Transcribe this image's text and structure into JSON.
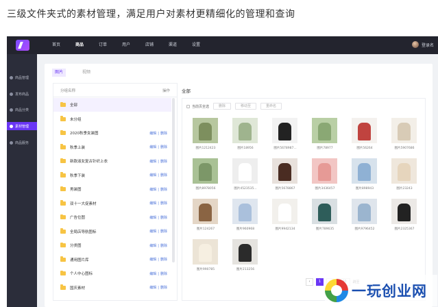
{
  "caption": "三级文件夹式的素材管理，满足用户对素材更精细化的管理和查询",
  "topbar": {
    "nav": [
      "首页",
      "商品",
      "订单",
      "用户",
      "店铺",
      "渠道",
      "设置"
    ],
    "active_nav": "商品",
    "user_label": "登录名"
  },
  "sidebar": {
    "items": [
      {
        "label": "商品管理",
        "icon": "box-icon"
      },
      {
        "label": "发布商品",
        "icon": "send-icon"
      },
      {
        "label": "商品分类",
        "icon": "category-icon"
      },
      {
        "label": "素材管理",
        "icon": "media-icon",
        "active": true
      },
      {
        "label": "商品服务",
        "icon": "service-icon"
      }
    ]
  },
  "tabs": [
    "图片",
    "视频"
  ],
  "groups": {
    "header_name": "分组名称",
    "header_action": "操作",
    "edit_label": "编辑",
    "delete_label": "删除",
    "separator": "|",
    "rows": [
      {
        "name": "全部",
        "actions": false,
        "selected": true
      },
      {
        "name": "未分组",
        "actions": false
      },
      {
        "name": "2020秋季女装图",
        "actions": true
      },
      {
        "name": "秋季上装",
        "actions": true
      },
      {
        "name": "新款淑女复古针织上衣",
        "actions": true
      },
      {
        "name": "秋季下装",
        "actions": true
      },
      {
        "name": "男装图",
        "actions": true
      },
      {
        "name": "双十一大促素材",
        "actions": true
      },
      {
        "name": "广告位图",
        "actions": true
      },
      {
        "name": "全局店导航图标",
        "actions": true
      },
      {
        "name": "分类图",
        "actions": true
      },
      {
        "name": "通用图片库",
        "actions": true
      },
      {
        "name": "个人中心图标",
        "actions": true
      },
      {
        "name": "国庆素材",
        "actions": true
      }
    ]
  },
  "gallery": {
    "title": "全部",
    "select_all": "当前页全选",
    "buttons": [
      "删除",
      "移动至",
      "重命名"
    ],
    "images": [
      {
        "caption": "图片1212423",
        "color": "#b7c79f",
        "accent": "#7d8f5e"
      },
      {
        "caption": "图片18956",
        "color": "#dfe7d7",
        "accent": "#9fb48e"
      },
      {
        "caption": "图片5678987...",
        "color": "#f2f2f2",
        "accent": "#222222"
      },
      {
        "caption": "图片78977",
        "color": "#b9cfa5",
        "accent": "#8aa874"
      },
      {
        "caption": "图片56264",
        "color": "#f4f1ee",
        "accent": "#c0433f"
      },
      {
        "caption": "图片5907686",
        "color": "#f3efe8",
        "accent": "#d8cbb6"
      },
      {
        "caption": "图片8978056",
        "color": "#a9c195",
        "accent": "#7c9768"
      },
      {
        "caption": "图片4523535...",
        "color": "#eeeeee",
        "accent": "#ffffff"
      },
      {
        "caption": "图片5678867",
        "color": "#e8e1dc",
        "accent": "#4a2c22"
      },
      {
        "caption": "图片3436457",
        "color": "#f2c6c4",
        "accent": "#e69a96"
      },
      {
        "caption": "图片898943",
        "color": "#d7e2ec",
        "accent": "#8fb1d4"
      },
      {
        "caption": "图片23243",
        "color": "#efe7dc",
        "accent": "#e6d5bd"
      },
      {
        "caption": "图片124267",
        "color": "#e4d6c6",
        "accent": "#8a6443"
      },
      {
        "caption": "图片960968",
        "color": "#dfe6ef",
        "accent": "#aac0dc"
      },
      {
        "caption": "图片9942134",
        "color": "#f2f0ec",
        "accent": "#ffffff"
      },
      {
        "caption": "图片789635",
        "color": "#d9dfe2",
        "accent": "#2e5d5a"
      },
      {
        "caption": "图片9796452",
        "color": "#dfe5ec",
        "accent": "#9bb5cf"
      },
      {
        "caption": "图片2325367",
        "color": "#ece9e6",
        "accent": "#222222"
      },
      {
        "caption": "图片990785",
        "color": "#ece4d6",
        "accent": "#f6efe1"
      },
      {
        "caption": "图片213256",
        "color": "#e5e3df",
        "accent": "#2b2b2b"
      }
    ]
  },
  "pagination": {
    "prev": "‹",
    "current": "1",
    "next": "›",
    "page_size": "100",
    "jump_label": "跳至"
  },
  "watermark": {
    "text": "一玩创业网"
  }
}
